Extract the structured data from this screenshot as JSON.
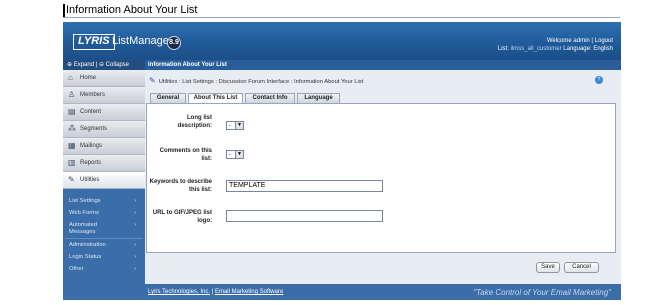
{
  "page": {
    "title": "Information About Your List"
  },
  "header": {
    "logo_text": "LYRIS",
    "product": "ListManager",
    "version": "8.9",
    "welcome_prefix": "Welcome admin | ",
    "logout_label": "Logout",
    "list_label": "List:",
    "list_value": "ilmss_all_customer",
    "language_label": "Language:",
    "language_value": "English"
  },
  "sidebar": {
    "expand_label": "Expand",
    "collapse_label": "Collapse",
    "separator": "|",
    "items": [
      {
        "label": "Home",
        "icon": "home-icon"
      },
      {
        "label": "Members",
        "icon": "members-icon"
      },
      {
        "label": "Content",
        "icon": "content-icon"
      },
      {
        "label": "Segments",
        "icon": "segments-icon"
      },
      {
        "label": "Mailings",
        "icon": "mailings-icon"
      },
      {
        "label": "Reports",
        "icon": "reports-icon"
      },
      {
        "label": "Utilities",
        "icon": "utilities-icon"
      }
    ],
    "subitems": [
      {
        "label": "List Settings",
        "arrow": "›"
      },
      {
        "label": "Web Forms",
        "arrow": "›"
      },
      {
        "label": "Automated Messages",
        "arrow": "›"
      },
      {
        "label": "Administration",
        "arrow": "›"
      },
      {
        "label": "Login Status",
        "arrow": "›"
      },
      {
        "label": "Other",
        "arrow": "›"
      }
    ]
  },
  "content": {
    "header": "Information About Your List",
    "breadcrumb": "Utilities : List Settings : Discussion Forum Interface : Information About Your List",
    "tabs": [
      "General",
      "About This List",
      "Contact Info",
      "Language"
    ],
    "fields": {
      "long_desc_label": "Long list description:",
      "long_desc_value": "-",
      "comments_label": "Comments on this list:",
      "comments_value": "-",
      "keywords_label": "Keywords to describe this list:",
      "keywords_value": "TEMPLATE",
      "logo_url_label": "URL to GIF/JPEG list logo:",
      "logo_url_value": ""
    },
    "buttons": {
      "save": "Save",
      "cancel": "Cancel"
    }
  },
  "footer": {
    "company": "Lyris Technologies, Inc.",
    "separator": "|",
    "link": "Email Marketing Software",
    "tagline": "\"Take Control of Your Email Marketing\""
  },
  "colors": {
    "header_blue": "#1f5997",
    "sidebar_blue": "#3b6da8",
    "content_header": "#2a5e9b"
  }
}
